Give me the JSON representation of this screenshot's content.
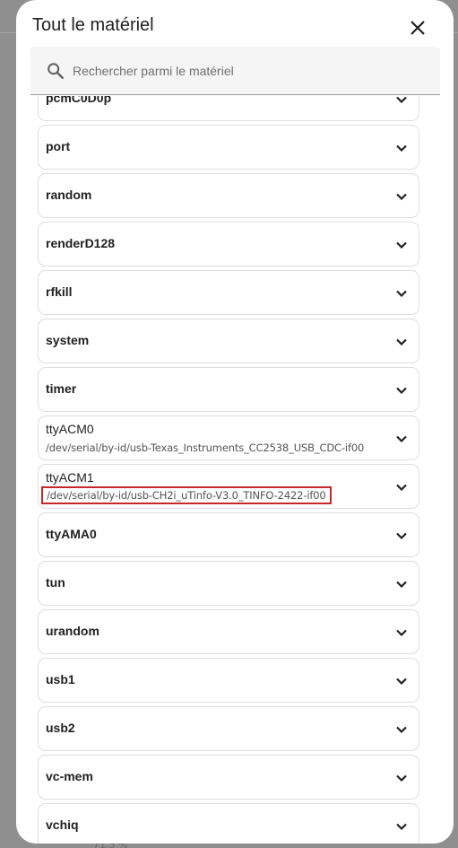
{
  "dialog": {
    "title": "Tout le matériel",
    "close_icon": "close-icon"
  },
  "search": {
    "placeholder": "Rechercher parmi le matériel",
    "value": "",
    "icon": "search-icon"
  },
  "items": [
    {
      "name": "pcmC0D0p"
    },
    {
      "name": "port"
    },
    {
      "name": "random"
    },
    {
      "name": "renderD128"
    },
    {
      "name": "rfkill"
    },
    {
      "name": "system"
    },
    {
      "name": "timer"
    },
    {
      "name": "ttyACM0",
      "sub": "/dev/serial/by-id/usb-Texas_Instruments_CC2538_USB_CDC-if00"
    },
    {
      "name": "ttyACM1",
      "sub": "/dev/serial/by-id/usb-CH2i_uTinfo-V3.0_TINFO-2422-if00",
      "highlighted": true
    },
    {
      "name": "ttyAMA0"
    },
    {
      "name": "tun"
    },
    {
      "name": "urandom"
    },
    {
      "name": "usb1"
    },
    {
      "name": "usb2"
    },
    {
      "name": "vc-mem"
    },
    {
      "name": "vchiq"
    }
  ],
  "background_fragment": "71,5 %",
  "colors": {
    "highlight_border": "#c62828",
    "dialog_bg": "#ffffff",
    "overlay": "#8f8f8f"
  }
}
